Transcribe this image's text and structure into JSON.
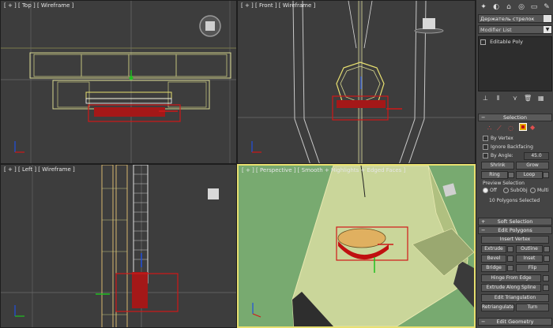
{
  "viewports": {
    "top": {
      "label": "[ + ] [ Top ] [ Wireframe ]"
    },
    "front": {
      "label": "[ + ] [ Front ] [ Wireframe ]"
    },
    "left": {
      "label": "[ + ] [ Left ] [ Wireframe ]"
    },
    "perspective": {
      "label": "[ + ] [ Perspective ] [ Smooth + Highlights + Edged Faces ]"
    }
  },
  "panel": {
    "object_name": "Держатель стрелок",
    "modifier_list": "Modifier List",
    "stack_item": "Editable Poly",
    "selection": {
      "title": "Selection",
      "by_vertex": "By Vertex",
      "ignore_backfacing": "Ignore Backfacing",
      "by_angle": "By Angle:",
      "angle_value": "45.0",
      "shrink": "Shrink",
      "grow": "Grow",
      "ring": "Ring",
      "loop": "Loop",
      "preview_title": "Preview Selection",
      "preview_off": "Off",
      "preview_subobj": "SubObj",
      "preview_multi": "Multi",
      "status": "10 Polygons Selected"
    },
    "soft_selection": "Soft Selection",
    "edit_polygons": {
      "title": "Edit Polygons",
      "insert_vertex": "Insert Vertex",
      "extrude": "Extrude",
      "outline": "Outline",
      "bevel": "Bevel",
      "inset": "Inset",
      "bridge": "Bridge",
      "flip": "Flip",
      "hinge_from_edge": "Hinge From Edge",
      "extrude_along_spline": "Extrude Along Spline",
      "edit_triangulation": "Edit Triangulation",
      "retriangulate": "Retriangulate",
      "turn": "Turn"
    },
    "edit_geometry": "Edit Geometry",
    "colors": {
      "accent": "#e8e070",
      "selection": "#c01010",
      "active_mode": "#e8a800"
    }
  }
}
